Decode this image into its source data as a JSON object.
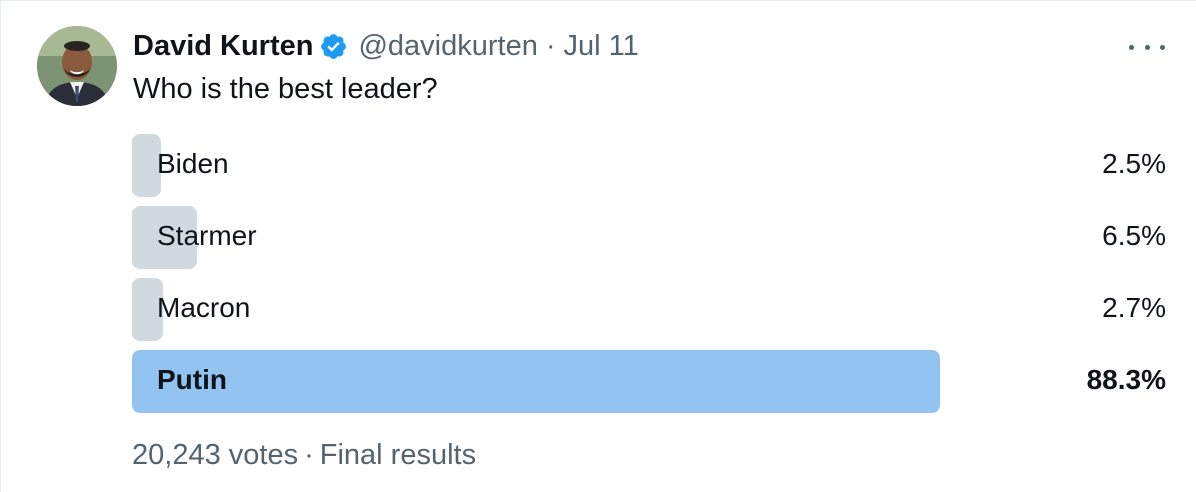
{
  "author": {
    "display_name": "David Kurten",
    "handle": "@davidkurten",
    "separator": "·",
    "date": "Jul 11",
    "verified_color": "#1d9bf0"
  },
  "icons": {
    "more": "more-horizontal-icon",
    "verified": "verified-badge-icon"
  },
  "tweet": {
    "text": "Who is the best leader?"
  },
  "poll": {
    "options": [
      {
        "label": "Biden",
        "percent_text": "2.5%",
        "percent": 2.5,
        "winner": false
      },
      {
        "label": "Starmer",
        "percent_text": "6.5%",
        "percent": 6.5,
        "winner": false
      },
      {
        "label": "Macron",
        "percent_text": "2.7%",
        "percent": 2.7,
        "winner": false
      },
      {
        "label": "Putin",
        "percent_text": "88.3%",
        "percent": 88.3,
        "winner": true
      }
    ],
    "votes_text": "20,243 votes",
    "separator": "·",
    "status_text": "Final results",
    "colors": {
      "bar": "#cfd9de",
      "winner_bar": "#93c3f1"
    }
  }
}
